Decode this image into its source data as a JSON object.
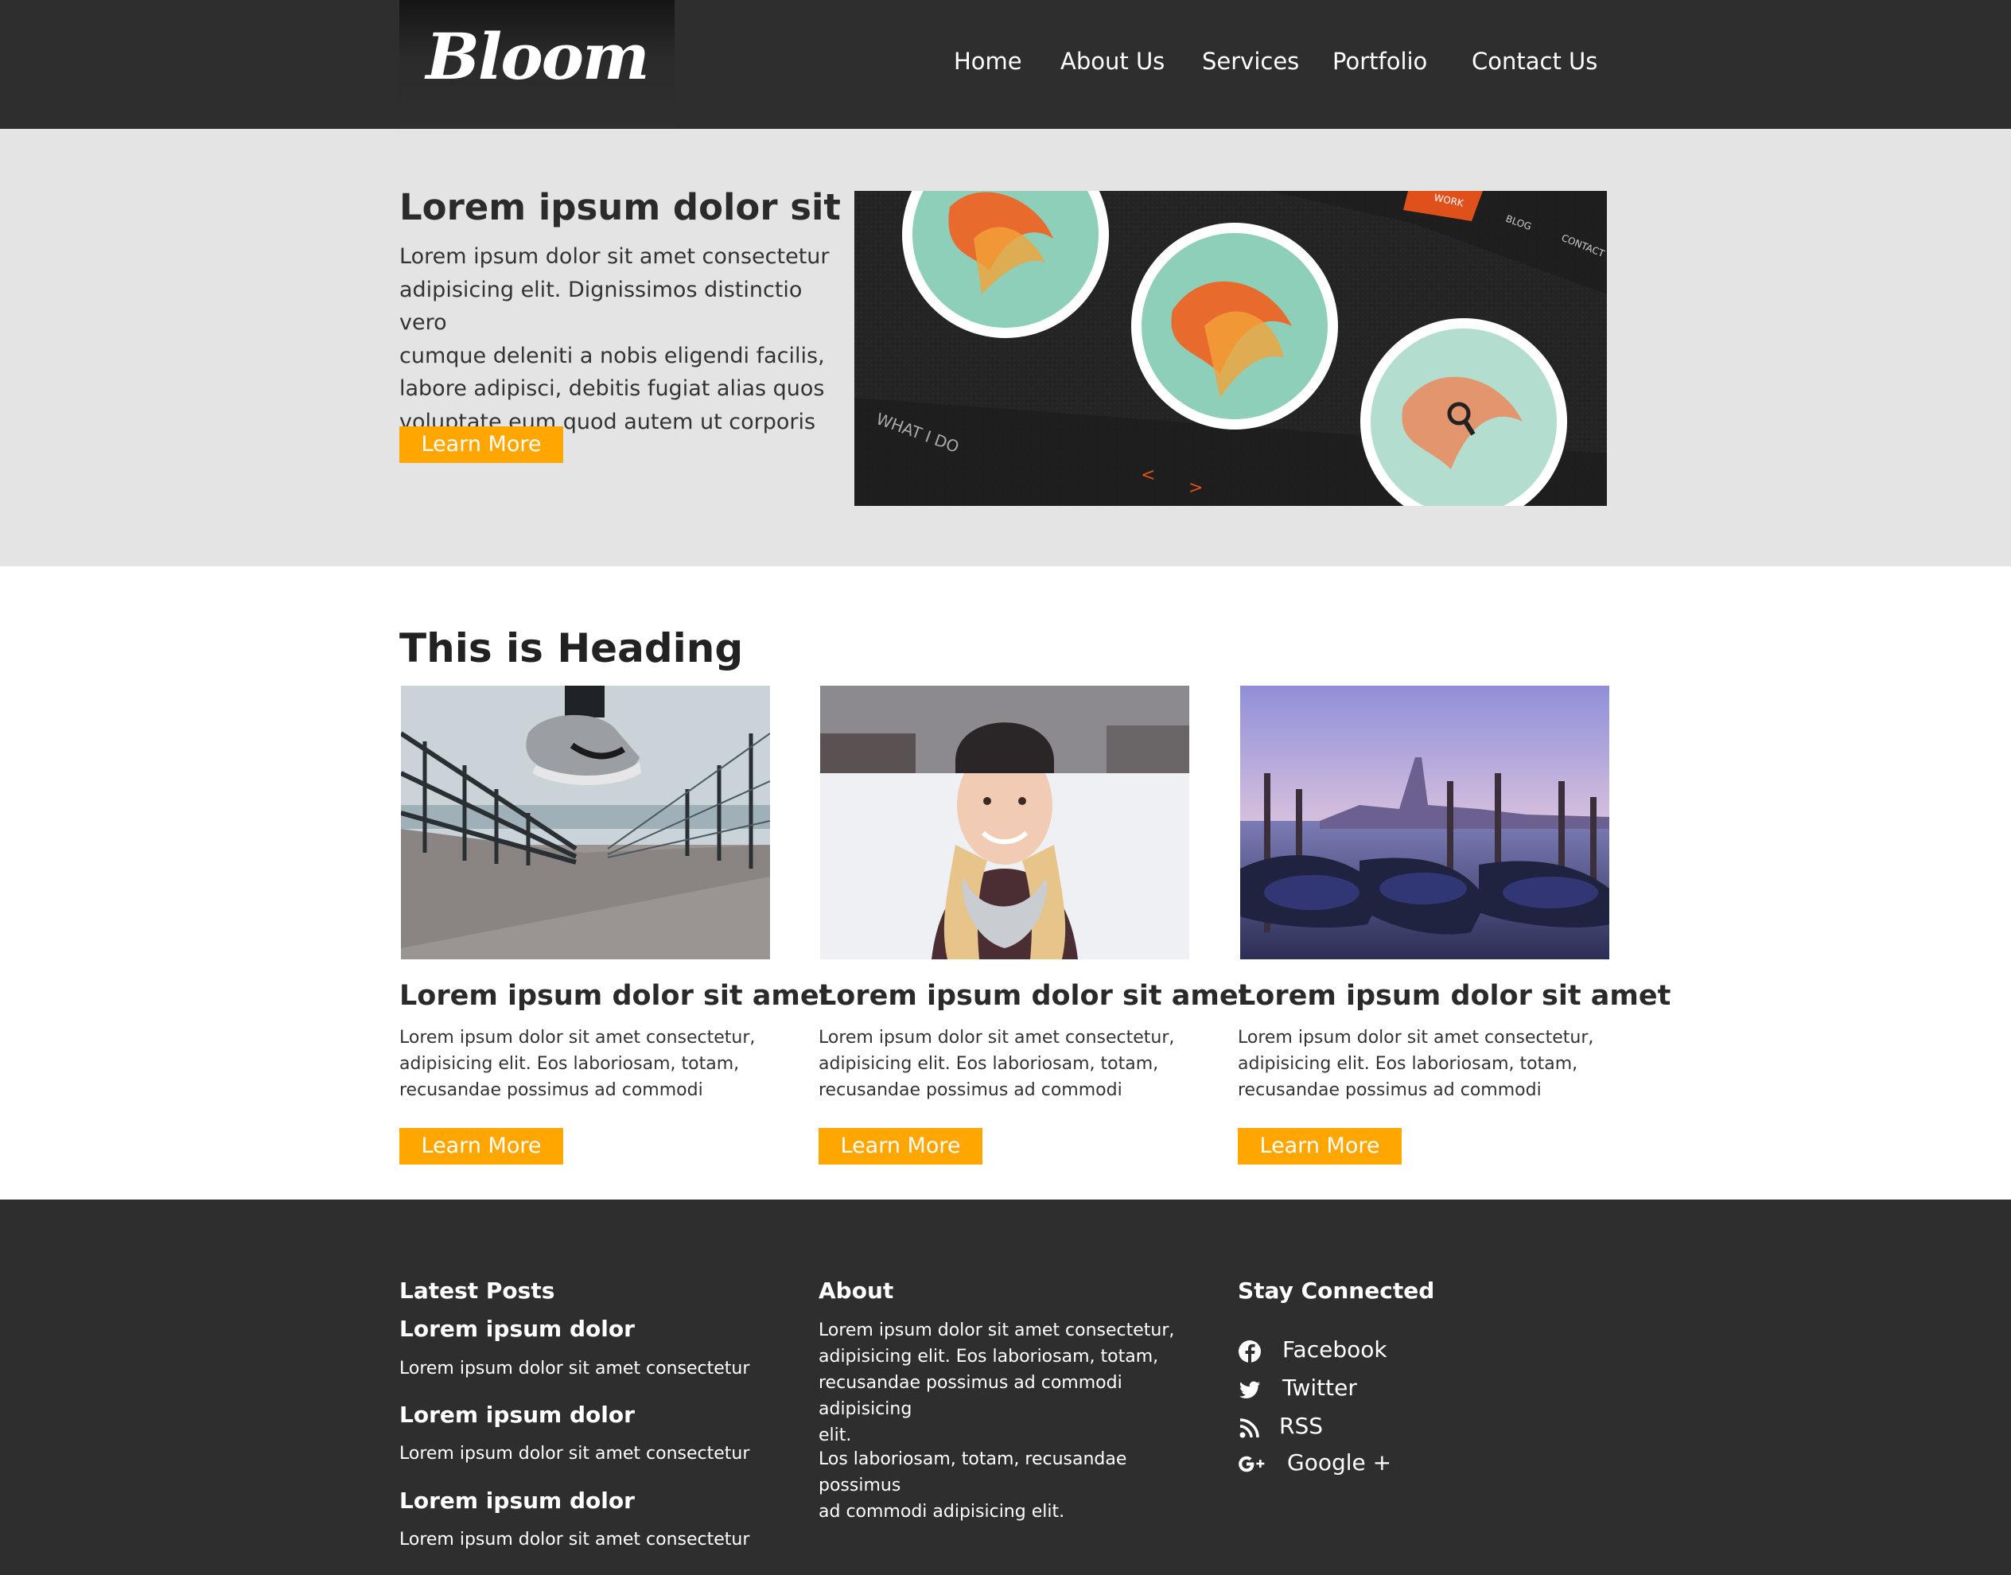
{
  "header": {
    "logo": "Bloom",
    "nav": [
      "Home",
      "About Us",
      "Services",
      "Portfolio",
      "Contact Us"
    ]
  },
  "hero": {
    "title": "Lorem ipsum dolor sit amet",
    "body_lines": [
      "Lorem ipsum dolor sit amet consectetur",
      "adipisicing elit. Dignissimos distinctio vero",
      "cumque deleniti a nobis eligendi facilis,",
      "labore adipisci, debitis fugiat alias quos",
      "voluptate eum quod autem ut corporis nulla."
    ],
    "button": "Learn More",
    "image_text": {
      "work": "WORK",
      "blog": "BLOG",
      "contact": "CONTACT",
      "what": "WHAT I DO"
    }
  },
  "section": {
    "heading": "This is Heading",
    "cards": [
      {
        "image": "sneaker-photo",
        "title": "Lorem ipsum dolor sit amet",
        "lines": [
          "Lorem ipsum dolor sit amet consectetur,",
          "adipisicing elit. Eos laboriosam, totam,",
          "recusandae possimus ad commodi"
        ],
        "button": "Learn More"
      },
      {
        "image": "woman-photo",
        "title": "Lorem ipsum dolor sit amet",
        "lines": [
          "Lorem ipsum dolor sit amet consectetur,",
          "adipisicing elit. Eos laboriosam, totam,",
          "recusandae possimus ad commodi"
        ],
        "button": "Learn More"
      },
      {
        "image": "gondolas-photo",
        "title": "Lorem ipsum dolor sit amet",
        "lines": [
          "Lorem ipsum dolor sit amet consectetur,",
          "adipisicing elit. Eos laboriosam, totam,",
          "recusandae possimus ad commodi"
        ],
        "button": "Learn More"
      }
    ]
  },
  "footer": {
    "latest_heading": "Latest Posts",
    "posts": [
      {
        "title": "Lorem ipsum dolor",
        "text": "Lorem ipsum dolor sit amet consectetur"
      },
      {
        "title": "Lorem ipsum dolor",
        "text": "Lorem ipsum dolor sit amet consectetur"
      },
      {
        "title": "Lorem ipsum dolor",
        "text": "Lorem ipsum dolor sit amet consectetur"
      }
    ],
    "about_heading": "About",
    "about_p1": [
      "Lorem ipsum dolor sit amet consectetur,",
      "adipisicing elit. Eos laboriosam, totam,",
      "recusandae possimus ad commodi adipisicing",
      "elit."
    ],
    "about_p2": [
      "Los laboriosam, totam, recusandae possimus",
      "ad commodi adipisicing elit."
    ],
    "connect_heading": "Stay Connected",
    "social": [
      {
        "icon": "facebook-icon",
        "label": "Facebook"
      },
      {
        "icon": "twitter-icon",
        "label": "Twitter"
      },
      {
        "icon": "rss-icon",
        "label": "RSS"
      },
      {
        "icon": "google-plus-icon",
        "label": "Google +"
      }
    ]
  },
  "colors": {
    "header_bg": "#2e2e2e",
    "hero_bg": "#e4e4e4",
    "accent": "#ffa600",
    "footer_bg": "#2e2e2e"
  }
}
